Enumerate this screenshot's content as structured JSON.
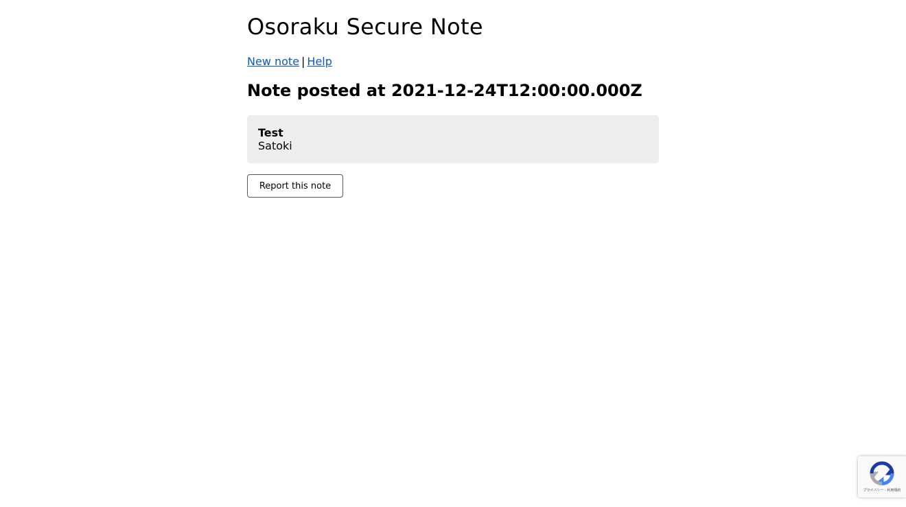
{
  "site": {
    "title": "Osoraku Secure Note"
  },
  "nav": {
    "new_note": "New note",
    "separator": "|",
    "help": "Help"
  },
  "note": {
    "heading": "Note posted at 2021-12-24T12:00:00.000Z",
    "title": "Test",
    "body": "Satoki"
  },
  "actions": {
    "report_label": "Report this note"
  },
  "recaptcha": {
    "links": "プライバシー - 利用規約"
  },
  "colors": {
    "link": "#0a58ca",
    "note_background": "#eeeeee",
    "recaptcha_blue": "#1c3aa9",
    "recaptcha_lightblue": "#4285f4",
    "recaptcha_gray": "#ababab"
  },
  "icons": {
    "recaptcha": "recaptcha-logo-icon"
  }
}
